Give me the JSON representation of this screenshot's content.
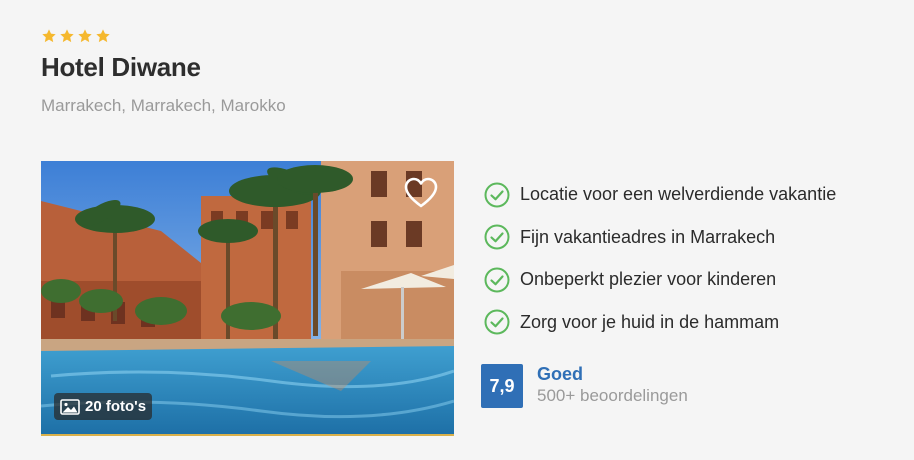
{
  "hotel": {
    "star_count": 4,
    "name": "Hotel Diwane",
    "location": "Marrakech, Marrakech, Marokko"
  },
  "photo": {
    "count_label": "20 foto's",
    "favorite_icon": "heart-outline-icon",
    "photo_icon": "image-icon"
  },
  "usps": [
    "Locatie voor een welverdiende vakantie",
    "Fijn vakantieadres in Marrakech",
    "Onbeperkt plezier voor kinderen",
    "Zorg voor je huid in de hammam"
  ],
  "rating": {
    "score": "7,9",
    "label": "Goed",
    "reviews": "500+ beoordelingen"
  },
  "colors": {
    "star": "#f5b82e",
    "check": "#5cb85c",
    "rating_blue": "#2f6fb6"
  }
}
